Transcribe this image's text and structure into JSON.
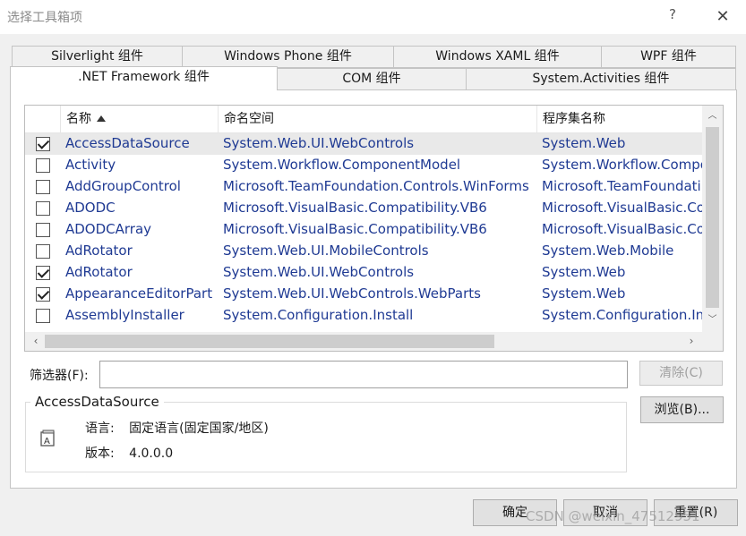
{
  "window": {
    "title": "选择工具箱项",
    "help": "?",
    "close": "✕"
  },
  "tabs": {
    "row_back": [
      "Silverlight 组件",
      "Windows Phone 组件",
      "Windows XAML 组件",
      "WPF 组件"
    ],
    "row_front": [
      ".NET Framework 组件",
      "COM 组件",
      "System.Activities 组件"
    ],
    "active": ".NET Framework 组件"
  },
  "list": {
    "columns": {
      "name": "名称",
      "namespace": "命名空间",
      "assembly": "程序集名称"
    },
    "sort_column": "名称",
    "rows": [
      {
        "checked": true,
        "name": "AccessDataSource",
        "namespace": "System.Web.UI.WebControls",
        "assembly": "System.Web"
      },
      {
        "checked": false,
        "name": "Activity",
        "namespace": "System.Workflow.ComponentModel",
        "assembly": "System.Workflow.Compo"
      },
      {
        "checked": false,
        "name": "AddGroupControl",
        "namespace": "Microsoft.TeamFoundation.Controls.WinForms",
        "assembly": "Microsoft.TeamFoundati"
      },
      {
        "checked": false,
        "name": "ADODC",
        "namespace": "Microsoft.VisualBasic.Compatibility.VB6",
        "assembly": "Microsoft.VisualBasic.Co"
      },
      {
        "checked": false,
        "name": "ADODCArray",
        "namespace": "Microsoft.VisualBasic.Compatibility.VB6",
        "assembly": "Microsoft.VisualBasic.Co"
      },
      {
        "checked": false,
        "name": "AdRotator",
        "namespace": "System.Web.UI.MobileControls",
        "assembly": "System.Web.Mobile"
      },
      {
        "checked": true,
        "name": "AdRotator",
        "namespace": "System.Web.UI.WebControls",
        "assembly": "System.Web"
      },
      {
        "checked": true,
        "name": "AppearanceEditorPart",
        "namespace": "System.Web.UI.WebControls.WebParts",
        "assembly": "System.Web"
      },
      {
        "checked": false,
        "name": "AssemblyInstaller",
        "namespace": "System.Configuration.Install",
        "assembly": "System.Configuration.Ins"
      }
    ],
    "selected_index": 0
  },
  "filter": {
    "label": "筛选器(F):",
    "value": "",
    "clear_label": "清除(C)"
  },
  "browse_label": "浏览(B)...",
  "details": {
    "title": "AccessDataSource",
    "language_label": "语言:",
    "language_value": "固定语言(固定国家/地区)",
    "version_label": "版本:",
    "version_value": "4.0.0.0"
  },
  "footer": {
    "ok": "确定",
    "cancel": "取消",
    "reset": "重置(R)"
  },
  "watermark": "CSDN @weixin_47512951",
  "colors": {
    "link_text": "#1f3a93",
    "selected_row": "#e9e9e9",
    "panel": "#ffffff",
    "dialog_bg": "#f0f0f0"
  }
}
